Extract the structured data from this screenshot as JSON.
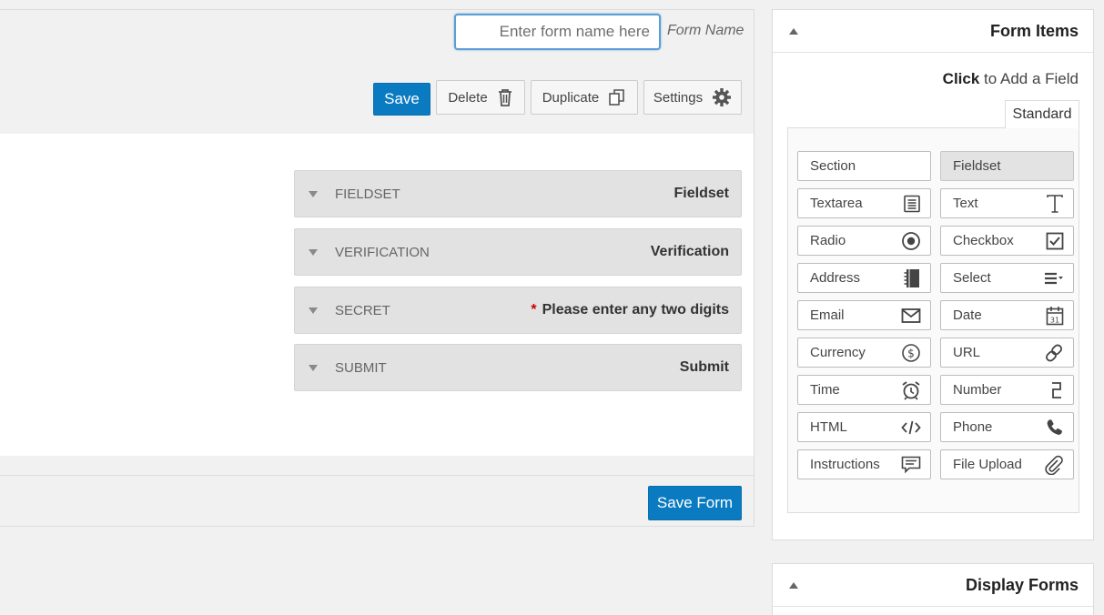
{
  "header": {
    "form_name_placeholder": "Enter form name here",
    "form_name_label": "Form Name"
  },
  "toolbar": {
    "save_label": "Save",
    "delete_label": "Delete",
    "duplicate_label": "Duplicate",
    "settings_label": "Settings"
  },
  "fields": [
    {
      "type": "FIELDSET",
      "label": "Fieldset",
      "required": ""
    },
    {
      "type": "VERIFICATION",
      "label": "Verification",
      "required": ""
    },
    {
      "type": "SECRET",
      "label": "Please enter any two digits",
      "required": "*"
    },
    {
      "type": "SUBMIT",
      "label": "Submit",
      "required": ""
    }
  ],
  "footer": {
    "save_form_label": "Save Form"
  },
  "sidebar": {
    "form_items": {
      "title": "Form Items",
      "hint_bold": "Click",
      "hint_rest": " to Add a Field",
      "tab_label": "Standard",
      "items": [
        {
          "label": "Section",
          "icon": "none"
        },
        {
          "label": "Fieldset",
          "icon": "none"
        },
        {
          "label": "Textarea",
          "icon": "textarea-icon"
        },
        {
          "label": "Text",
          "icon": "text-icon"
        },
        {
          "label": "Radio",
          "icon": "radio-icon"
        },
        {
          "label": "Checkbox",
          "icon": "checkbox-icon"
        },
        {
          "label": "Address",
          "icon": "address-book-icon"
        },
        {
          "label": "Select",
          "icon": "select-icon"
        },
        {
          "label": "Email",
          "icon": "envelope-icon"
        },
        {
          "label": "Date",
          "icon": "calendar-icon"
        },
        {
          "label": "Currency",
          "icon": "dollar-icon"
        },
        {
          "label": "URL",
          "icon": "link-icon"
        },
        {
          "label": "Time",
          "icon": "alarm-clock-icon"
        },
        {
          "label": "Number",
          "icon": "number-icon"
        },
        {
          "label": "HTML",
          "icon": "code-icon"
        },
        {
          "label": "Phone",
          "icon": "phone-icon"
        },
        {
          "label": "Instructions",
          "icon": "comment-icon"
        },
        {
          "label": "File Upload",
          "icon": "paperclip-icon"
        }
      ]
    },
    "display_forms": {
      "title": "Display Forms"
    }
  },
  "colors": {
    "primary_button": "#0b7bc1",
    "required_marker": "#cc0000",
    "field_row_bg": "#e2e2e2"
  }
}
